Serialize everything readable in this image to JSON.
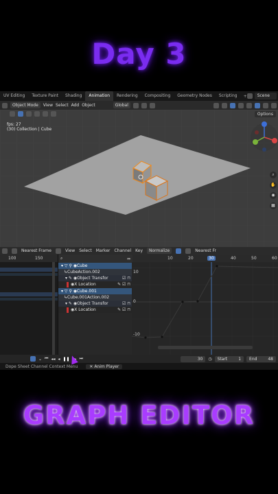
{
  "overlay": {
    "top_title": "Day 3",
    "bottom_title": "GRAPH EDITOR"
  },
  "workspace_tabs": [
    {
      "label": "UV Editing"
    },
    {
      "label": "Texture Paint"
    },
    {
      "label": "Shading"
    },
    {
      "label": "Animation"
    },
    {
      "label": "Rendering"
    },
    {
      "label": "Compositing"
    },
    {
      "label": "Geometry Nodes"
    },
    {
      "label": "Scripting"
    }
  ],
  "workspace_add": "+",
  "scene": {
    "label": "Scene"
  },
  "viewport_header": {
    "mode": "Object Mode",
    "menus": [
      "View",
      "Select",
      "Add",
      "Object"
    ],
    "orientation": "Global"
  },
  "viewport": {
    "fps": "fps: 27",
    "info": "(30) Collection | Cube",
    "options": "Options"
  },
  "gizmo": {
    "z": "Z"
  },
  "graph_header": {
    "nearest_frame": "Nearest Frame",
    "menus": [
      "View",
      "Select",
      "Marker",
      "Channel",
      "Key"
    ],
    "normalize": "Normalize",
    "nearest_frame_right": "Nearest Fr"
  },
  "ruler": {
    "left_ticks": [
      "100",
      "150"
    ],
    "right_ticks": [
      "10",
      "20",
      "30",
      "40",
      "50",
      "60"
    ],
    "current_frame": "30"
  },
  "channels": {
    "rows": [
      {
        "label": "Cube",
        "kind": "obj"
      },
      {
        "label": "CubeAction.002",
        "kind": "act"
      },
      {
        "label": "Object Transfor",
        "kind": "grp"
      },
      {
        "label": "X Location",
        "kind": "fc"
      },
      {
        "label": "Cube.001",
        "kind": "obj"
      },
      {
        "label": "Cube.001Action.002",
        "kind": "act"
      },
      {
        "label": "Object Transfor",
        "kind": "grp"
      },
      {
        "label": "X Location",
        "kind": "fc"
      }
    ]
  },
  "curve_axis": {
    "y_ticks": [
      "10",
      "0",
      "-10"
    ]
  },
  "timeline": {
    "frame": "30",
    "start_label": "Start",
    "start_value": "1",
    "end_label": "End",
    "end_value": "48"
  },
  "status_bar": {
    "context": "Dope Sheet Channel Context Menu",
    "player": "Anim Player"
  }
}
